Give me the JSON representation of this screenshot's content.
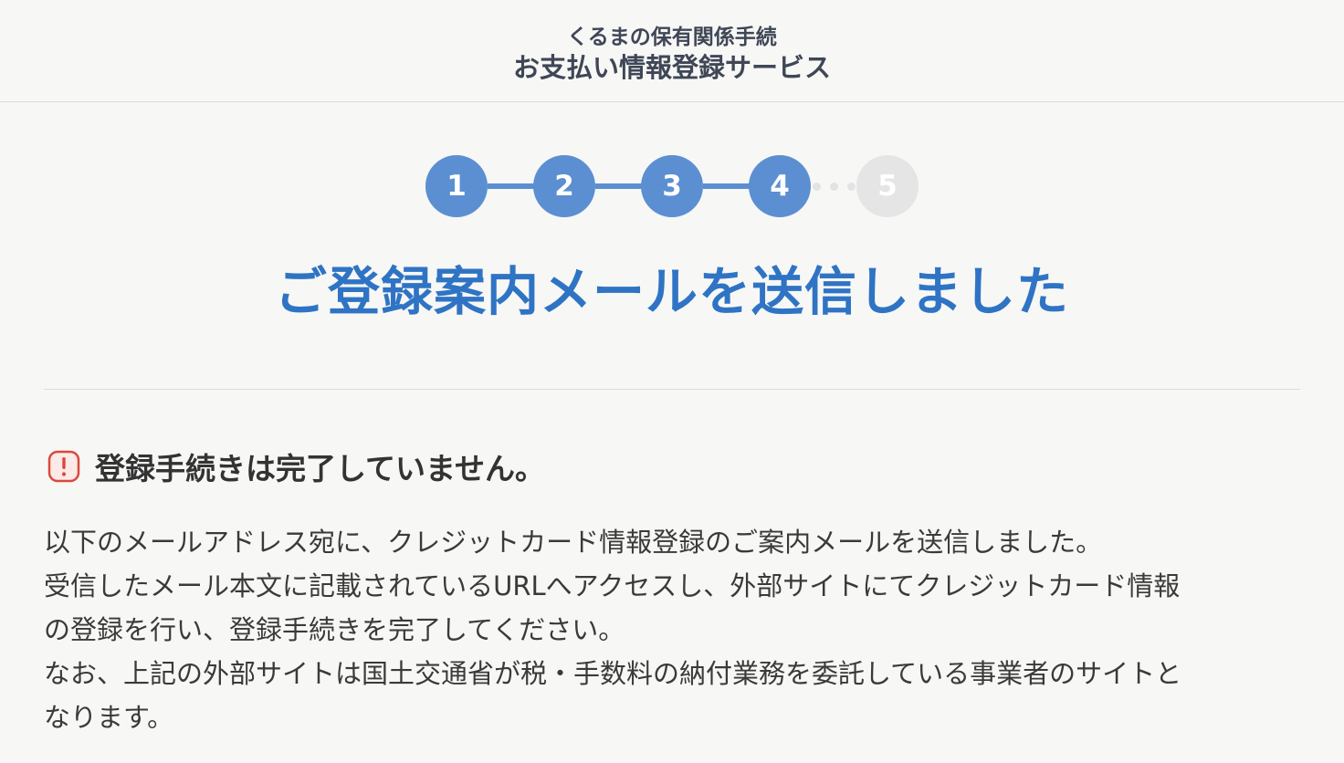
{
  "header": {
    "subtitle": "くるまの保有関係手続",
    "title": "お支払い情報登録サービス"
  },
  "stepper": {
    "steps": [
      {
        "label": "1",
        "state": "complete"
      },
      {
        "label": "2",
        "state": "complete"
      },
      {
        "label": "3",
        "state": "complete"
      },
      {
        "label": "4",
        "state": "current"
      },
      {
        "label": "5",
        "state": "pending"
      }
    ],
    "active_color": "#5b8fd2",
    "pending_color": "#e5e5e5"
  },
  "main": {
    "title": "ご登録案内メールを送信しました",
    "title_color": "#2f74c4",
    "alert": {
      "icon": "exclamation-alert-icon",
      "icon_color": "#d9493d",
      "text": "登録手続きは完了していません。"
    },
    "body_lines": [
      "以下のメールアドレス宛に、クレジットカード情報登録のご案内メールを送信しました。",
      "受信したメール本文に記載されているURLへアクセスし、外部サイトにてクレジットカード情報",
      "の登録を行い、登録手続きを完了してください。",
      "なお、上記の外部サイトは国土交通省が税・手数料の納付業務を委託している事業者のサイトと",
      "なります。"
    ]
  }
}
